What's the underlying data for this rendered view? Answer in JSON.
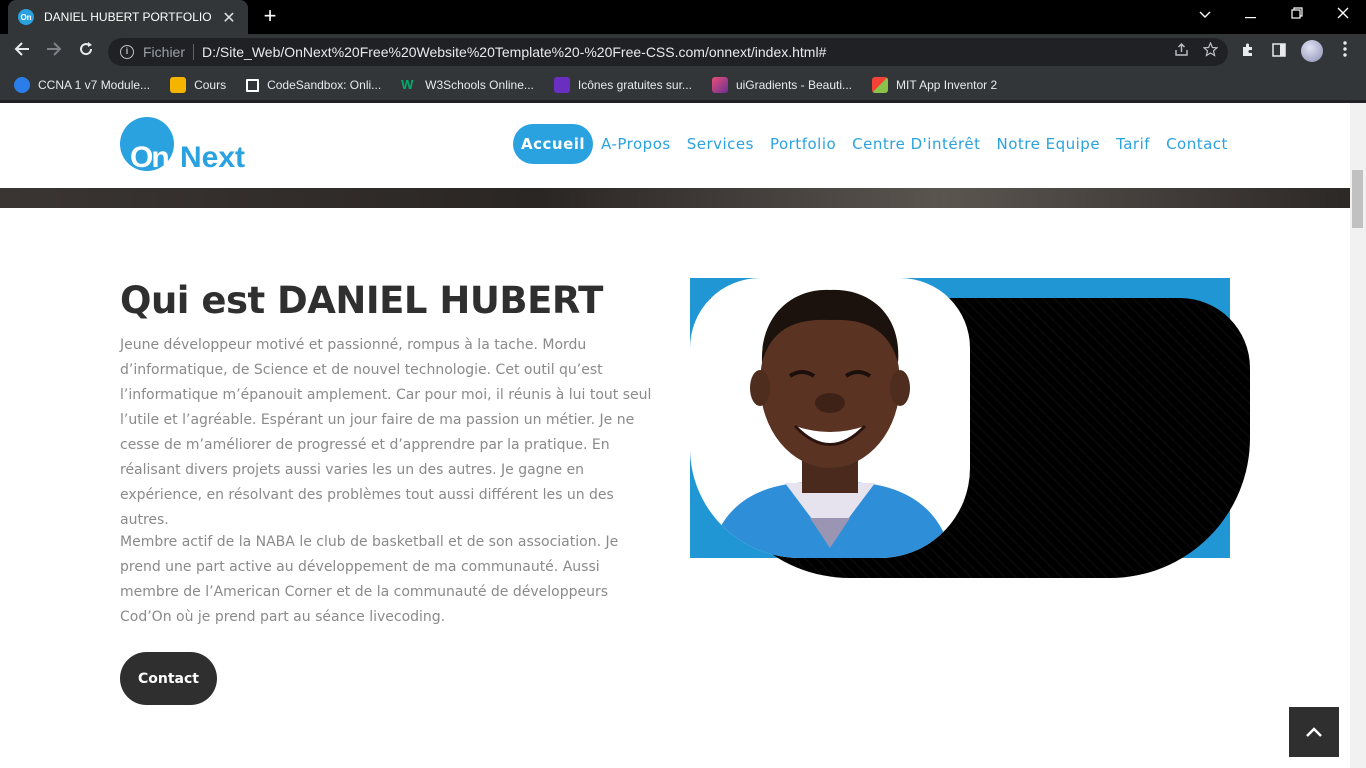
{
  "browser": {
    "tab_title": "DANIEL HUBERT PORTFOLIO",
    "tab_close": "✕",
    "new_tab": "+",
    "omnibox_label": "Fichier",
    "url": "D:/Site_Web/OnNext%20Free%20Website%20Template%20-%20Free-CSS.com/onnext/index.html#",
    "bookmarks": [
      {
        "label": "CCNA 1 v7 Module...",
        "color": "#2b7de9"
      },
      {
        "label": "Cours",
        "color": "#f4b400"
      },
      {
        "label": "CodeSandbox: Onli...",
        "color": "#ffffff"
      },
      {
        "label": "W3Schools Online...",
        "color": "#04aa6d"
      },
      {
        "label": "Icônes gratuites sur...",
        "color": "#6a2fc1"
      },
      {
        "label": "uiGradients - Beauti...",
        "color": "#c84e89"
      },
      {
        "label": "MIT App Inventor 2",
        "color": "#8bc34a"
      }
    ]
  },
  "site": {
    "logo_on": "On",
    "logo_next": "Next",
    "nav": [
      "Accueil",
      "A-Propos",
      "Services",
      "Portfolio",
      "Centre D'intérêt",
      "Notre Equipe",
      "Tarif",
      "Contact"
    ],
    "accent_color": "#2ba2e0"
  },
  "about": {
    "title": "Qui est DANIEL HUBERT",
    "paragraph1": "Jeune développeur motivé et passionné, rompus à la tache. Mordu d’informatique, de Science et de nouvel technologie. Cet outil qu’est l’informatique m’épanouit amplement. Car pour moi, il réunis à lui tout seul l’utile et l’agréable. Espérant un jour faire de ma passion un métier. Je ne cesse de m’améliorer de progressé et d’apprendre par la pratique. En réalisant divers projets aussi varies les un des autres. Je gagne en expérience, en résolvant des problèmes tout aussi différent les un des autres.",
    "paragraph2": "Membre actif de la NABA le club de basketball et de son association. Je prend une part active au développement de ma communauté. Aussi membre de l’American Corner et de la communauté de développeurs Cod’On où je prend part au séance livecoding.",
    "contact_button": "Contact"
  }
}
